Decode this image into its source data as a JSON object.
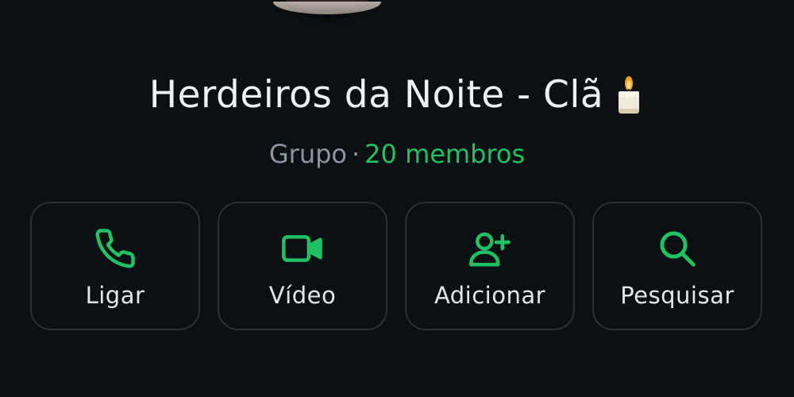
{
  "group": {
    "name": "Herdeiros da Noite - Clã",
    "name_emoji": "candle",
    "type_label": "Grupo",
    "separator": "·",
    "members_label": "20 membros"
  },
  "actions": [
    {
      "label": "Ligar",
      "icon": "phone-icon"
    },
    {
      "label": "Vídeo",
      "icon": "video-camera-icon"
    },
    {
      "label": "Adicionar",
      "icon": "add-person-icon"
    },
    {
      "label": "Pesquisar",
      "icon": "search-icon"
    }
  ],
  "colors": {
    "background": "#0b1014",
    "accent": "#21c063",
    "text_primary": "#eef0f2",
    "text_secondary": "#8d969c",
    "card_border": "#2a3136"
  }
}
